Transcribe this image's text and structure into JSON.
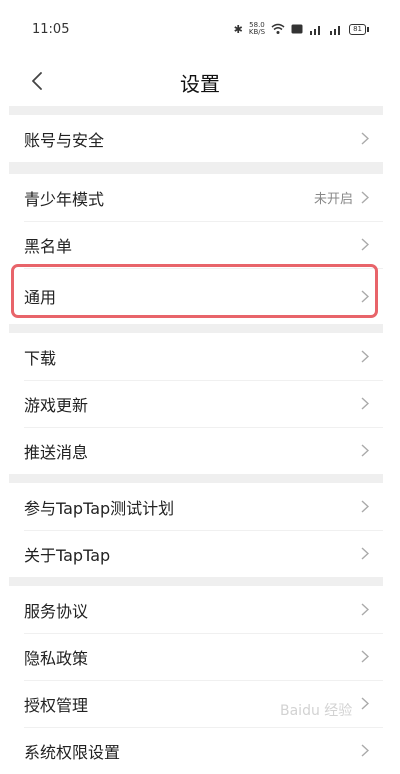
{
  "status_bar": {
    "time": "11:05",
    "net_speed_top": "58.0",
    "net_speed_bottom": "KB/S",
    "battery": "81"
  },
  "nav": {
    "title": "设置"
  },
  "groups": [
    [
      {
        "label": "账号与安全"
      }
    ],
    [
      {
        "label": "青少年模式",
        "value": "未开启"
      },
      {
        "label": "黑名单"
      },
      {
        "label": "通用"
      }
    ],
    [
      {
        "label": "下载"
      },
      {
        "label": "游戏更新"
      },
      {
        "label": "推送消息"
      }
    ],
    [
      {
        "label": "参与TapTap测试计划"
      },
      {
        "label": "关于TapTap"
      }
    ],
    [
      {
        "label": "服务协议"
      },
      {
        "label": "隐私政策"
      },
      {
        "label": "授权管理"
      },
      {
        "label": "系统权限设置"
      }
    ]
  ],
  "watermark": "Baidu 经验"
}
